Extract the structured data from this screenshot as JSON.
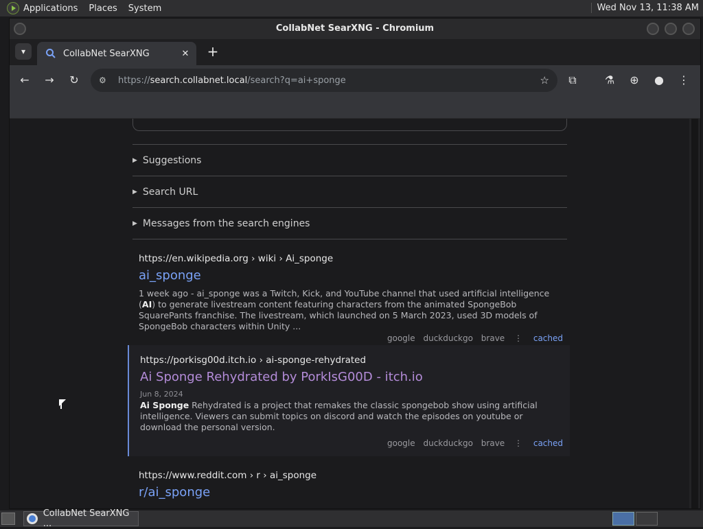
{
  "top_panel": {
    "menus": [
      "Applications",
      "Places",
      "System"
    ],
    "clock": "Wed Nov 13, 11:38 AM"
  },
  "window": {
    "title": "CollabNet SearXNG - Chromium"
  },
  "tab": {
    "title": "CollabNet SearXNG",
    "close": "✕",
    "new_tab": "+"
  },
  "address": {
    "scheme": "https://",
    "host": "search.collabnet.local",
    "path": "/search?q=ai+sponge"
  },
  "details": [
    {
      "label": "Suggestions"
    },
    {
      "label": "Search URL"
    },
    {
      "label": "Messages from the search engines"
    }
  ],
  "results": [
    {
      "url": "https://en.wikipedia.org  › wiki › Ai_sponge",
      "title": "ai_sponge",
      "date": "",
      "content_html": "1 week ago - ai_sponge was a Twitch, Kick, and YouTube channel that used artificial intelligence (<b>AI</b>) to generate livestream content featuring characters from the animated SpongeBob SquarePants franchise. The livestream, which launched on 5 March 2023, used 3D models of SpongeBob characters within Unity ...",
      "engines": [
        "google",
        "duckduckgo",
        "brave"
      ],
      "cached": "cached"
    },
    {
      "url": "https://porkisg00d.itch.io  › ai-sponge-rehydrated",
      "title": "Ai Sponge Rehydrated by PorkIsG00D - itch.io",
      "date": "Jun 8, 2024",
      "content_html": "<b>Ai Sponge</b> Rehydrated is a project that remakes the classic spongebob show using artificial intelligence. Viewers can submit topics on discord and watch the episodes on youtube or download the personal version.",
      "engines": [
        "google",
        "duckduckgo",
        "brave"
      ],
      "cached": "cached"
    },
    {
      "url": "https://www.reddit.com  › r › ai_sponge",
      "title": "r/ai_sponge"
    }
  ],
  "taskbar": {
    "task_label": "CollabNet SearXNG ..."
  }
}
